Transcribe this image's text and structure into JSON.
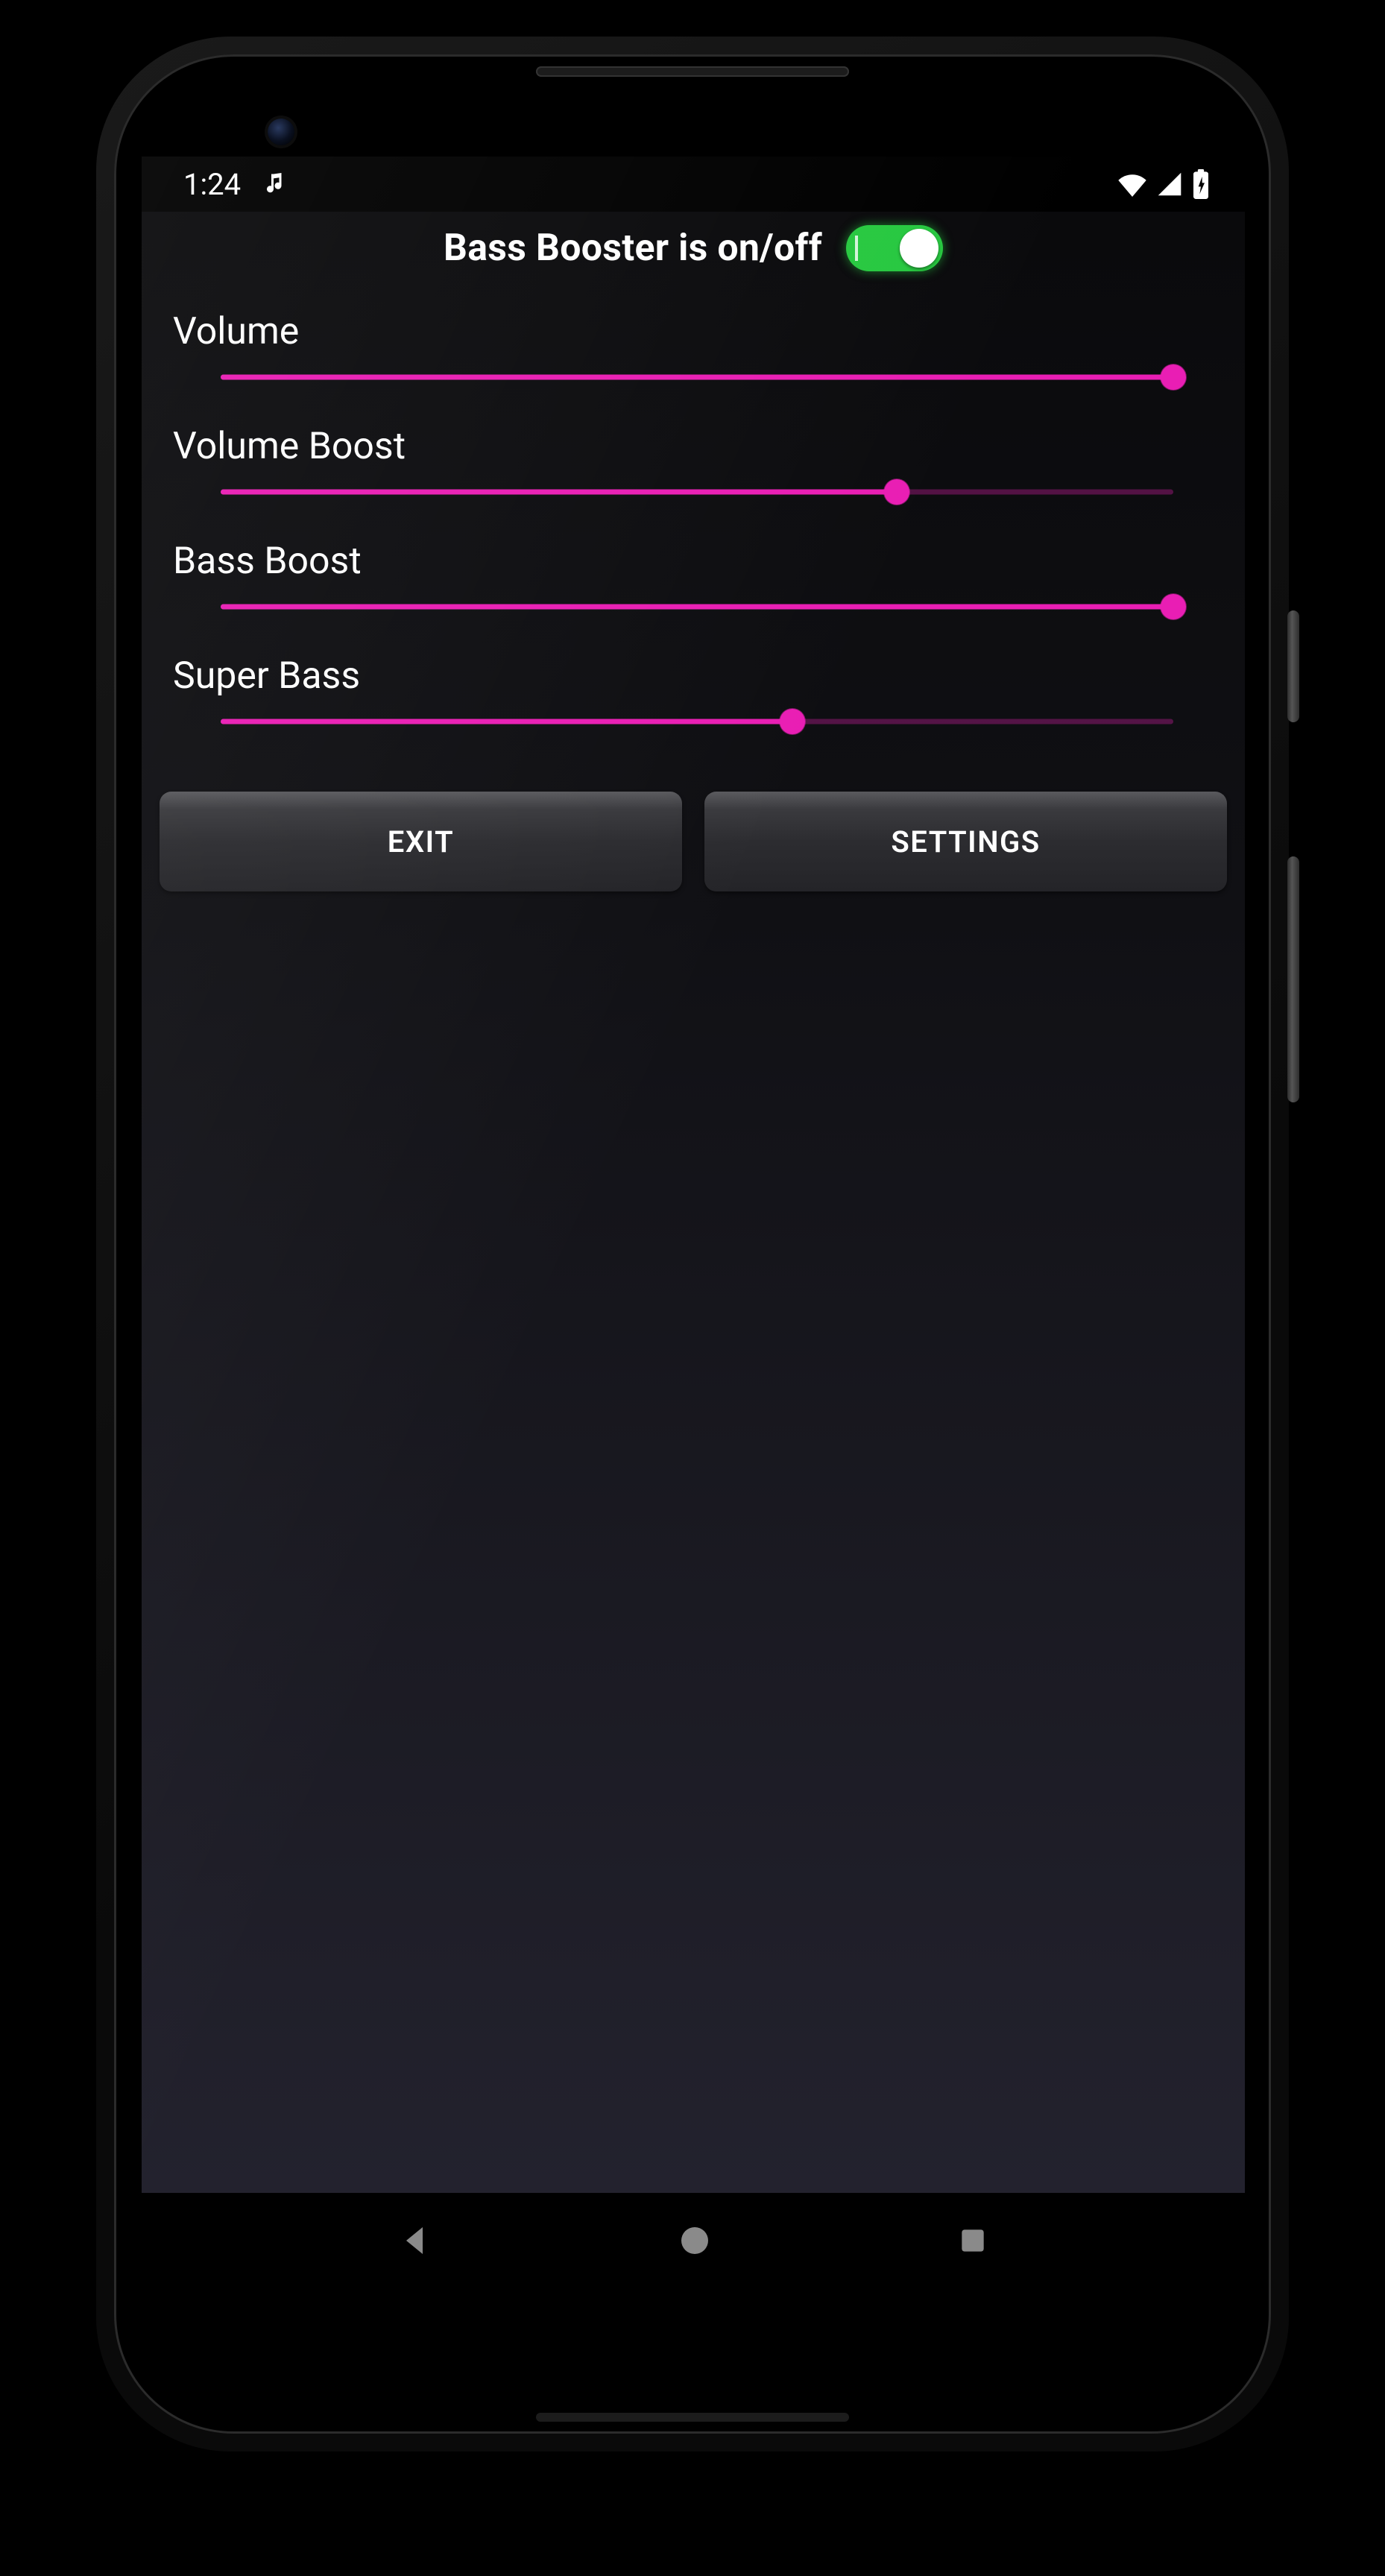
{
  "status": {
    "time": "1:24",
    "music_icon": "music-note-icon",
    "wifi_icon": "wifi-icon",
    "signal_icon": "cell-signal-icon",
    "battery_icon": "battery-charging-icon"
  },
  "header": {
    "title": "Bass Booster is on/off",
    "toggle_on": true
  },
  "controls": [
    {
      "key": "volume",
      "label": "Volume",
      "value_pct": 100
    },
    {
      "key": "volume_boost",
      "label": "Volume Boost",
      "value_pct": 71
    },
    {
      "key": "bass_boost",
      "label": "Bass Boost",
      "value_pct": 100
    },
    {
      "key": "super_bass",
      "label": "Super Bass",
      "value_pct": 60
    }
  ],
  "buttons": {
    "exit": "EXIT",
    "settings": "SETTINGS"
  },
  "colors": {
    "slider": "#e91eb4",
    "switch": "#27c840"
  },
  "nav": {
    "back": "nav-back-icon",
    "home": "nav-home-icon",
    "recent": "nav-recent-icon"
  }
}
